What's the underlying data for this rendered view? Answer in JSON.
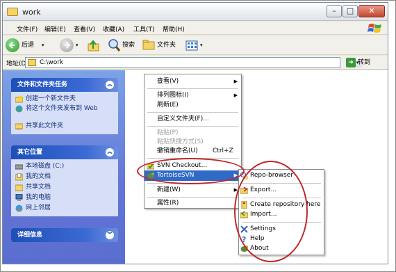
{
  "window": {
    "title": "work"
  },
  "menubar": {
    "items": [
      "文件(F)",
      "编辑(E)",
      "查看(V)",
      "收藏(A)",
      "工具(T)",
      "帮助(H)"
    ]
  },
  "toolbar": {
    "back_label": "后退",
    "search_label": "搜索",
    "folders_label": "文件夹"
  },
  "address": {
    "label": "地址(D)",
    "value": "C:\\work",
    "go_label": "转到"
  },
  "tasks_panel": {
    "title": "文件和文件夹任务",
    "items": [
      {
        "label": "创建一个新文件夹",
        "icon": "new-folder-icon"
      },
      {
        "label": "将这个文件夹发布到 Web",
        "icon": "publish-web-icon"
      },
      {
        "label": "共享此文件夹",
        "icon": "share-folder-icon"
      }
    ]
  },
  "places_panel": {
    "title": "其它位置",
    "items": [
      {
        "label": "本地磁盘 (C:)",
        "icon": "drive-icon"
      },
      {
        "label": "我的文档",
        "icon": "documents-icon"
      },
      {
        "label": "共享文档",
        "icon": "shared-docs-icon"
      },
      {
        "label": "我的电脑",
        "icon": "computer-icon"
      },
      {
        "label": "网上邻居",
        "icon": "network-icon"
      }
    ]
  },
  "details_panel": {
    "title": "详细信息"
  },
  "context_menu": {
    "view": "查看(V)",
    "arrange": "排列图标(I)",
    "refresh": "刷新(E)",
    "customize": "自定义文件夹(F)...",
    "paste": "粘贴(P)",
    "paste_shortcut": "粘贴快捷方式(S)",
    "undo_rename": "撤销重命名(U)",
    "undo_shortcut": "Ctrl+Z",
    "svn_checkout": "SVN Checkout...",
    "tortoise": "TortoiseSVN",
    "new": "新建(W)",
    "properties": "属性(R)"
  },
  "svn_submenu": {
    "repo_browser": "Repo-browser",
    "export": "Export...",
    "create_repo": "Create repository here",
    "import": "Import...",
    "settings": "Settings",
    "help": "Help",
    "about": "About"
  },
  "colors": {
    "selection": "#316ac5",
    "panel_gradient_top": "#7ba2e7",
    "annotation_ring": "#c0262a"
  }
}
